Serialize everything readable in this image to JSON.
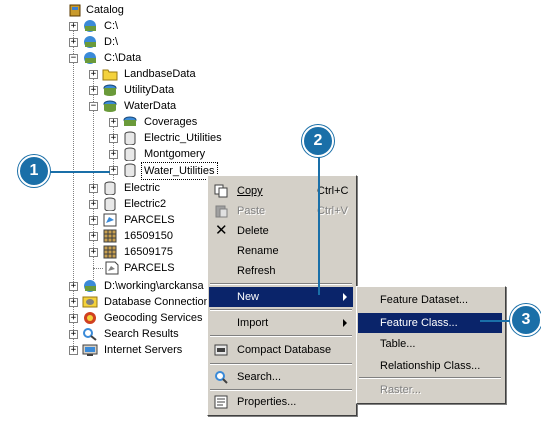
{
  "tree": {
    "root": "Catalog",
    "items": [
      {
        "label": "C:\\"
      },
      {
        "label": "D:\\"
      },
      {
        "label": "C:\\Data"
      },
      {
        "label": "LandbaseData"
      },
      {
        "label": "UtilityData"
      },
      {
        "label": "WaterData"
      },
      {
        "label": "Coverages"
      },
      {
        "label": "Electric_Utilities"
      },
      {
        "label": "Montgomery"
      },
      {
        "label": "Water_Utilities"
      },
      {
        "label": "Electric"
      },
      {
        "label": "Electric2"
      },
      {
        "label": "PARCELS"
      },
      {
        "label": "16509150"
      },
      {
        "label": "16509175"
      },
      {
        "label": "PARCELS"
      },
      {
        "label": "D:\\working\\arckansa"
      },
      {
        "label": "Database Connection"
      },
      {
        "label": "Geocoding Services"
      },
      {
        "label": "Search Results"
      },
      {
        "label": "Internet Servers"
      }
    ]
  },
  "context_menu": {
    "copy": "Copy",
    "copy_shortcut": "Ctrl+C",
    "paste": "Paste",
    "paste_shortcut": "Ctrl+V",
    "delete": "Delete",
    "rename": "Rename",
    "refresh": "Refresh",
    "new": "New",
    "import": "Import",
    "compact": "Compact Database",
    "search": "Search...",
    "properties": "Properties..."
  },
  "submenu": {
    "feature_dataset": "Feature Dataset...",
    "feature_class": "Feature Class...",
    "table": "Table...",
    "relationship_class": "Relationship Class...",
    "raster": "Raster..."
  },
  "callouts": {
    "one": "1",
    "two": "2",
    "three": "3"
  },
  "colors": {
    "highlight": "#0a246a",
    "callout": "#1a6fa8",
    "menu_bg": "#d4d0c8"
  }
}
